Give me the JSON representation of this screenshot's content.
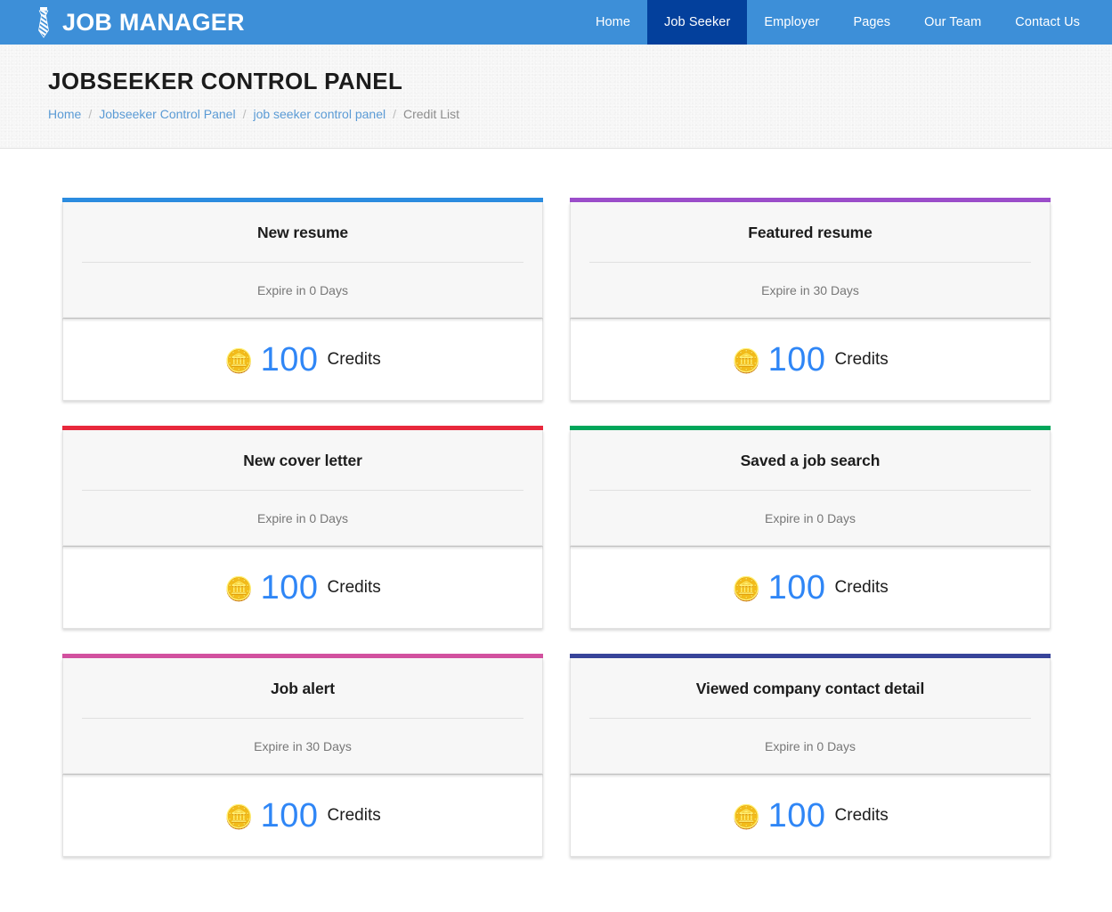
{
  "navbar": {
    "brand_label": "JOB MANAGER",
    "brand_icon": "necktie-icon",
    "background_color": "#3d8fd8",
    "active_color": "#03409c",
    "items": [
      {
        "label": "Home",
        "active": false
      },
      {
        "label": "Job Seeker",
        "active": true
      },
      {
        "label": "Employer",
        "active": false
      },
      {
        "label": "Pages",
        "active": false
      },
      {
        "label": "Our Team",
        "active": false
      },
      {
        "label": "Contact Us",
        "active": false
      }
    ]
  },
  "banner": {
    "title": "JOBSEEKER CONTROL PANEL",
    "breadcrumb": [
      {
        "label": "Home",
        "link": true
      },
      {
        "label": "Jobseeker Control Panel",
        "link": true
      },
      {
        "label": "job seeker control panel",
        "link": true
      },
      {
        "label": "Credit List",
        "link": false
      }
    ],
    "separator": "/"
  },
  "credits": {
    "unit_label": "Credits",
    "coin_icon": "coins-icon",
    "amount_color": "#2f86f6",
    "cards": [
      {
        "title": "New resume",
        "expire": "Expire in 0 Days",
        "amount": "100",
        "accent_color": "#2b8ce0"
      },
      {
        "title": "Featured resume",
        "expire": "Expire in 30 Days",
        "amount": "100",
        "accent_color": "#9b4dca"
      },
      {
        "title": "New cover letter",
        "expire": "Expire in 0 Days",
        "amount": "100",
        "accent_color": "#e8283c"
      },
      {
        "title": "Saved a job search",
        "expire": "Expire in 0 Days",
        "amount": "100",
        "accent_color": "#00a65a"
      },
      {
        "title": "Job alert",
        "expire": "Expire in 30 Days",
        "amount": "100",
        "accent_color": "#d2519f"
      },
      {
        "title": "Viewed company contact detail",
        "expire": "Expire in 0 Days",
        "amount": "100",
        "accent_color": "#38449a"
      }
    ]
  }
}
